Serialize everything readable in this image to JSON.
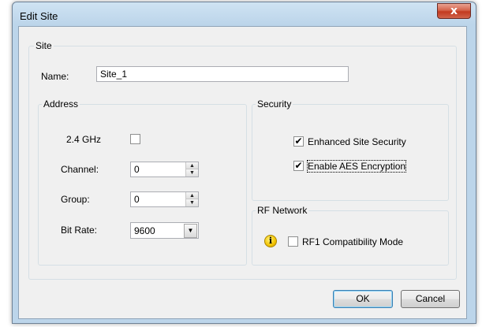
{
  "window": {
    "title": "Edit Site",
    "close_glyph": "x"
  },
  "site": {
    "legend": "Site",
    "name_label": "Name:",
    "name_value": "Site_1"
  },
  "address": {
    "legend": "Address",
    "ghz_label": "2.4 GHz",
    "ghz_checked": false,
    "channel_label": "Channel:",
    "channel_value": "0",
    "group_label": "Group:",
    "group_value": "0",
    "bitrate_label": "Bit Rate:",
    "bitrate_value": "9600"
  },
  "security": {
    "legend": "Security",
    "enhanced_label": "Enhanced Site Security",
    "enhanced_checked": true,
    "aes_label": "Enable AES Encryption",
    "aes_checked": true
  },
  "rf_network": {
    "legend": "RF Network",
    "info_icon": "info-icon",
    "rf1_label": "RF1 Compatibility Mode",
    "rf1_checked": false
  },
  "buttons": {
    "ok": "OK",
    "cancel": "Cancel"
  },
  "glyphs": {
    "check": "✔",
    "up": "▲",
    "down": "▼",
    "info": "i"
  },
  "colors": {
    "title_bar": "#bcd5ea",
    "client": "#f0f0f0",
    "close_button": "#c23a1f",
    "info_icon": "#f3c300"
  }
}
